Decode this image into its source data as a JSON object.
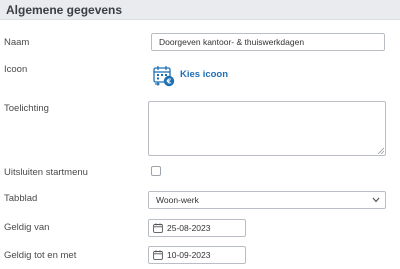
{
  "header": {
    "title": "Algemene gegevens"
  },
  "fields": {
    "naam": {
      "label": "Naam",
      "value": "Doorgeven kantoor- & thuiswerkdagen"
    },
    "icoon": {
      "label": "Icoon",
      "link_label": "Kies icoon",
      "icon": "calendar-euro-icon"
    },
    "toelichting": {
      "label": "Toelichting",
      "value": ""
    },
    "uitsluiten": {
      "label": "Uitsluiten startmenu",
      "checked": false
    },
    "tabblad": {
      "label": "Tabblad",
      "value": "Woon-werk"
    },
    "geldig_van": {
      "label": "Geldig van",
      "value": "25-08-2023"
    },
    "geldig_tot": {
      "label": "Geldig tot en met",
      "value": "10-09-2023"
    }
  },
  "colors": {
    "accent": "#1f6fb5",
    "header_bg": "#e9ebee",
    "border": "#b9bec5"
  }
}
